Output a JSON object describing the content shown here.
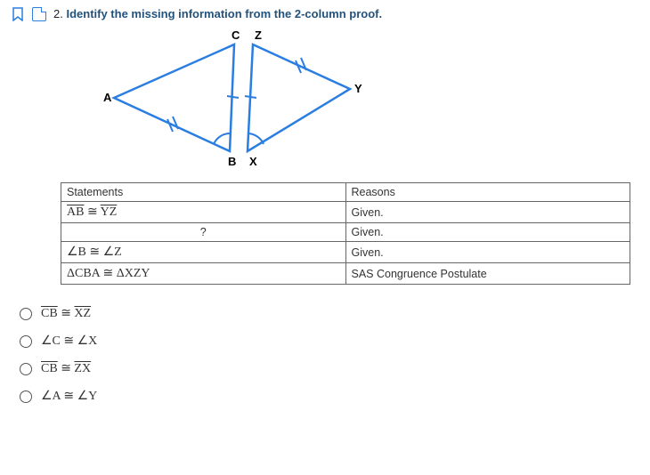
{
  "header": {
    "number": "2.",
    "prompt_bold": "Identify the missing information from the 2-column proof.",
    "bookmark_name": "bookmark-icon",
    "note_name": "note-icon"
  },
  "diagram": {
    "labels": {
      "A": "A",
      "B": "B",
      "C": "C",
      "X": "X",
      "Y": "Y",
      "Z": "Z"
    }
  },
  "table": {
    "headers": {
      "statements": "Statements",
      "reasons": "Reasons"
    },
    "rows": [
      {
        "statement_html": "AB ≅ YZ",
        "statement_seg": true,
        "reason": "Given."
      },
      {
        "statement_html": "?",
        "center": true,
        "reason": "Given."
      },
      {
        "statement_html": "∠B ≅ ∠Z",
        "reason": "Given."
      },
      {
        "statement_html": "ΔCBA ≅ ΔXZY",
        "reason": "SAS Congruence Postulate"
      }
    ]
  },
  "choices": [
    {
      "label_html": "CB ≅ XZ",
      "seg": true
    },
    {
      "label_html": "∠C ≅ ∠X"
    },
    {
      "label_html": "CB ≅ ZX",
      "seg": true
    },
    {
      "label_html": "∠A ≅ ∠Y"
    }
  ]
}
